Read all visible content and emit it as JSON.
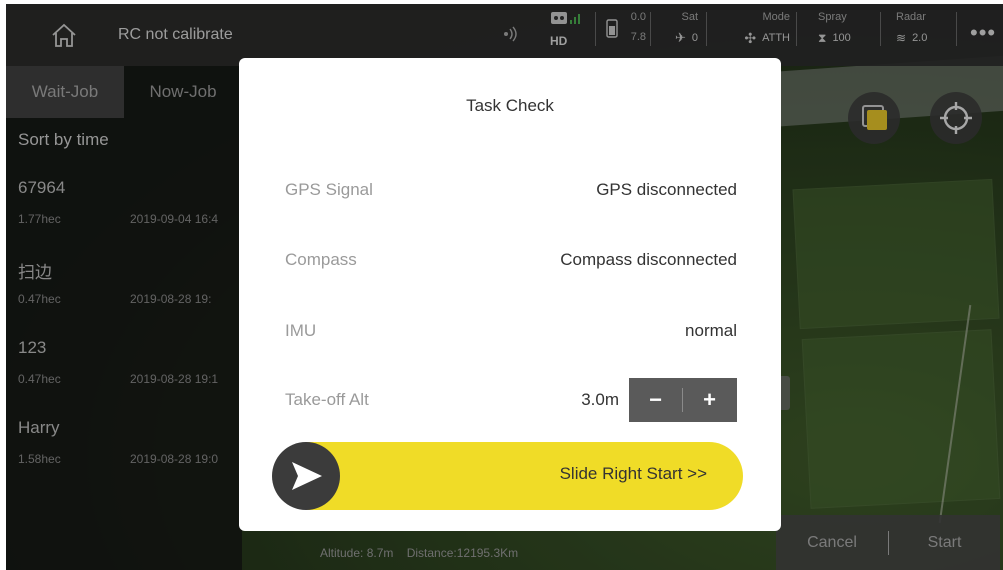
{
  "topbar": {
    "rc_status": "RC not calibrate",
    "hd_label": "HD",
    "battery": {
      "v1": "0.0",
      "v2": "7.8"
    },
    "sat": {
      "label": "Sat",
      "value": "0"
    },
    "mode": {
      "label": "Mode",
      "value": "ATTH"
    },
    "spray": {
      "label": "Spray",
      "value": "100"
    },
    "radar": {
      "label": "Radar",
      "value": "2.0"
    },
    "more": "•••"
  },
  "left_panel": {
    "tabs": [
      {
        "label": "Wait-Job",
        "active": true
      },
      {
        "label": "Now-Job",
        "active": false
      }
    ],
    "sort": "Sort by time",
    "jobs": [
      {
        "name": "67964",
        "area": "1.77hec",
        "date": "2019-09-04 16:4"
      },
      {
        "name": "扫边",
        "area": "0.47hec",
        "date": "2019-08-28 19:"
      },
      {
        "name": "123",
        "area": "0.47hec",
        "date": "2019-08-28 19:1"
      },
      {
        "name": "Harry",
        "area": "1.58hec",
        "date": "2019-08-28 19:0"
      }
    ]
  },
  "bottom": {
    "altitude": "Altitude: 8.7m",
    "distance": "Distance:12195.3Km",
    "cancel": "Cancel",
    "start": "Start"
  },
  "modal": {
    "title": "Task Check",
    "rows": [
      {
        "label": "GPS Signal",
        "value": "GPS disconnected"
      },
      {
        "label": "Compass",
        "value": "Compass disconnected"
      },
      {
        "label": "IMU",
        "value": "normal"
      }
    ],
    "takeoff": {
      "label": "Take-off Alt",
      "value": "3.0m",
      "minus": "−",
      "plus": "+"
    },
    "slider_label": "Slide Right Start >>"
  },
  "colors": {
    "accent": "#f0dc27",
    "alert": "#e04a3a",
    "knob": "#3b3b3b"
  }
}
